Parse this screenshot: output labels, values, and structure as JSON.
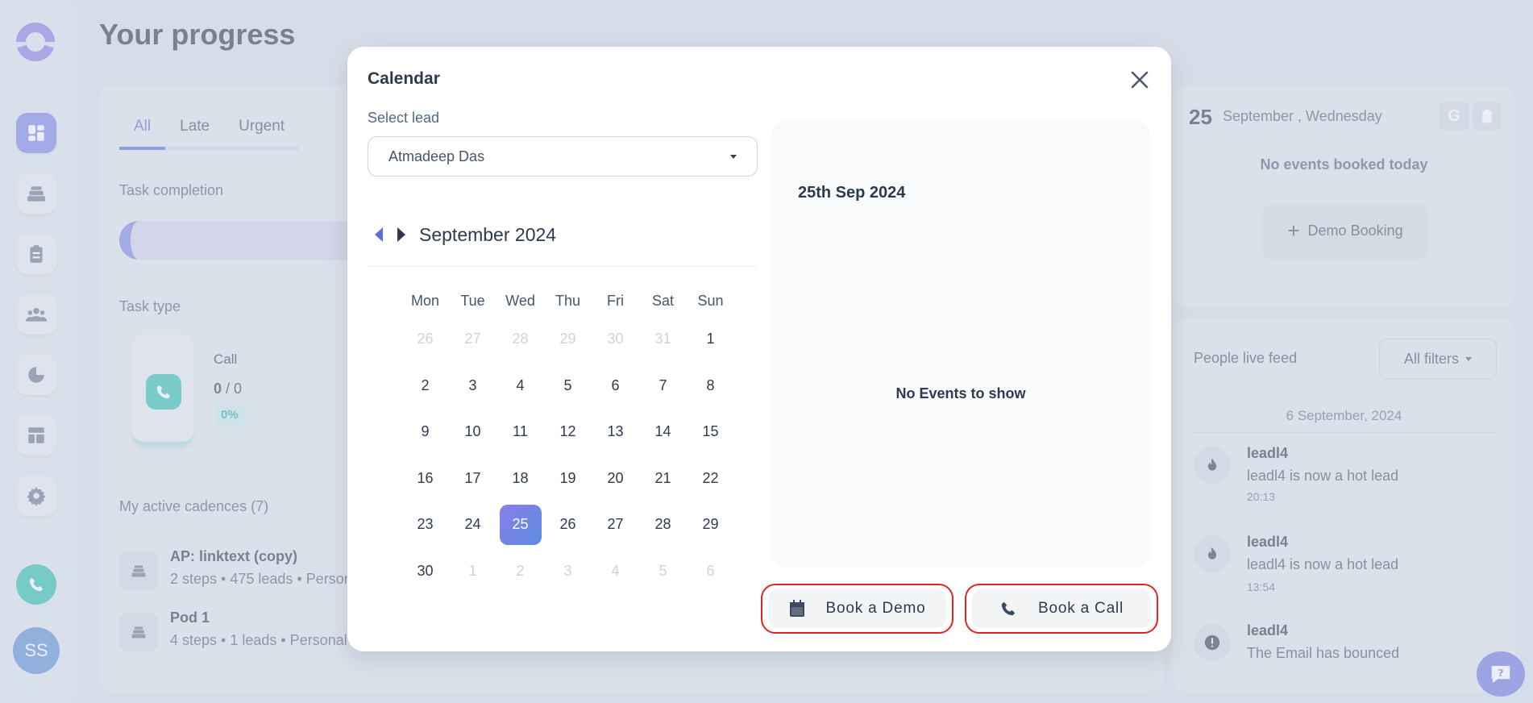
{
  "page": {
    "title": "Your progress"
  },
  "user": {
    "initials": "SS"
  },
  "tabs": [
    "All",
    "Late",
    "Urgent"
  ],
  "sections": {
    "task_completion": "Task completion",
    "task_type": "Task type",
    "active_cadences": "My active cadences (7)"
  },
  "task_call": {
    "label": "Call",
    "done": "0",
    "total": " / 0",
    "percent": "0%"
  },
  "cadences": [
    {
      "title": "AP: linktext (copy)",
      "sub": "2 steps • 475 leads • Personal"
    },
    {
      "title": "Pod 1",
      "sub": "4 steps • 1 leads • Personal"
    }
  ],
  "agenda": {
    "day": "25",
    "date_text": "September , Wednesday",
    "google_letter": "G",
    "empty": "No events booked today",
    "demo_booking": "Demo Booking"
  },
  "feed": {
    "title": "People live feed",
    "filters": "All filters",
    "date": "6 September, 2024",
    "items": [
      {
        "name": "leadl4",
        "text": "leadl4 is now a hot lead",
        "time": "20:13",
        "icon": "flame-icon"
      },
      {
        "name": "leadl4",
        "text": "leadl4 is now a hot lead",
        "time": "13:54",
        "icon": "flame-icon"
      },
      {
        "name": "leadl4",
        "text": "The Email has bounced",
        "time": "",
        "icon": "alert-icon"
      }
    ]
  },
  "modal": {
    "title": "Calendar",
    "select_label": "Select lead",
    "selected_lead": "Atmadeep Das",
    "month": "September 2024",
    "weekdays": [
      "Mon",
      "Tue",
      "Wed",
      "Thu",
      "Fri",
      "Sat",
      "Sun"
    ],
    "days": [
      {
        "d": "26",
        "m": true
      },
      {
        "d": "27",
        "m": true
      },
      {
        "d": "28",
        "m": true
      },
      {
        "d": "29",
        "m": true
      },
      {
        "d": "30",
        "m": true
      },
      {
        "d": "31",
        "m": true
      },
      {
        "d": "1"
      },
      {
        "d": "2"
      },
      {
        "d": "3"
      },
      {
        "d": "4"
      },
      {
        "d": "5"
      },
      {
        "d": "6"
      },
      {
        "d": "7"
      },
      {
        "d": "8"
      },
      {
        "d": "9"
      },
      {
        "d": "10"
      },
      {
        "d": "11"
      },
      {
        "d": "12"
      },
      {
        "d": "13"
      },
      {
        "d": "14"
      },
      {
        "d": "15"
      },
      {
        "d": "16"
      },
      {
        "d": "17"
      },
      {
        "d": "18"
      },
      {
        "d": "19"
      },
      {
        "d": "20"
      },
      {
        "d": "21"
      },
      {
        "d": "22"
      },
      {
        "d": "23"
      },
      {
        "d": "24"
      },
      {
        "d": "25",
        "s": true
      },
      {
        "d": "26"
      },
      {
        "d": "27"
      },
      {
        "d": "28"
      },
      {
        "d": "29"
      },
      {
        "d": "30"
      },
      {
        "d": "1",
        "m": true
      },
      {
        "d": "2",
        "m": true
      },
      {
        "d": "3",
        "m": true
      },
      {
        "d": "4",
        "m": true
      },
      {
        "d": "5",
        "m": true
      },
      {
        "d": "6",
        "m": true
      }
    ],
    "event_date": "25th Sep 2024",
    "no_events": "No Events to show",
    "book_demo": "Book a Demo",
    "book_call": "Book a Call"
  },
  "colors": {
    "accent": "#5b6fd8",
    "teal": "#2bbfb0",
    "danger": "#e02424",
    "selected_gradient_start": "#8a7ee8"
  }
}
